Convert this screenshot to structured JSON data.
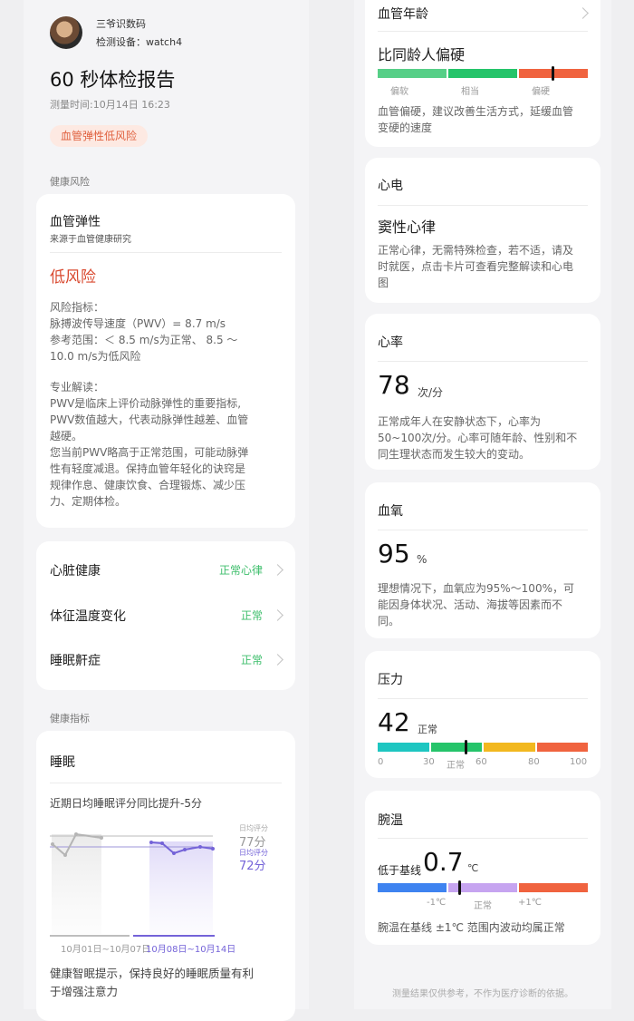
{
  "profile": {
    "name": "三爷识数码",
    "device": "检测设备：watch4"
  },
  "report": {
    "title": "60 秒体检报告",
    "time": "测量时间:10月14日 16:23",
    "risk_badge": "血管弹性低风险"
  },
  "health_risk": {
    "section_label": "健康风险",
    "title": "血管弹性",
    "source": "来源于血管健康研究",
    "level": "低风险",
    "indicator_heading": "风险指标：",
    "indicator_line1": "脉搏波传导速度（PWV）= 8.7 m/s",
    "indicator_line2": "参考范围：＜ 8.5 m/s为正常、 8.5 ～",
    "indicator_line3": "10.0 m/s为低风险",
    "interp_heading": "专业解读：",
    "interp_lines": [
      "PWV是临床上评价动脉弹性的重要指标,",
      "PWV数值越大，代表动脉弹性越差、血管",
      "越硬。",
      "您当前PWV略高于正常范围，可能动脉弹",
      "性有轻度减退。保持血管年轻化的诀窍是",
      "规律作息、健康饮食、合理锻炼、减少压",
      "力、定期体检。"
    ]
  },
  "checks": [
    {
      "label": "心脏健康",
      "status": "正常心律"
    },
    {
      "label": "体征温度变化",
      "status": "正常"
    },
    {
      "label": "睡眠鼾症",
      "status": "正常"
    }
  ],
  "indicators": {
    "section_label": "健康指标",
    "sleep": {
      "title": "睡眠",
      "subtitle": "近期日均睡眠评分同比提升-5分",
      "prev_avg_label": "日均评分",
      "prev_avg_value": "77分",
      "curr_avg_label": "日均评分",
      "curr_avg_value": "72分",
      "range_prev": "10月01日~10月07日",
      "range_curr": "10月08日~10月14日",
      "tip_line1": "健康智眠提示，保持良好的睡眠质量有利",
      "tip_line2": "于增强注意力"
    }
  },
  "right": {
    "vascular_age": {
      "title": "血管年龄",
      "result": "比同龄人偏硬",
      "labels": [
        "偏软",
        "相当",
        "偏硬"
      ],
      "desc_line1": "血管偏硬，建议改善生活方式，延缓血管",
      "desc_line2": "变硬的速度"
    },
    "ecg": {
      "title": "心电",
      "result": "窦性心律",
      "desc_line1": "正常心律，无需特殊检查，若不适，请及",
      "desc_line2": "时就医，点击卡片可查看完整解读和心电",
      "desc_line3": "图"
    },
    "heart_rate": {
      "title": "心率",
      "value": "78",
      "unit": "次/分",
      "desc_line1": "正常成年人在安静状态下，心率为",
      "desc_line2": "50~100次/分。心率可随年龄、性别和不",
      "desc_line3": "同生理状态而发生较大的变动。"
    },
    "spo2": {
      "title": "血氧",
      "value": "95",
      "unit": "%",
      "desc_line1": "理想情况下，血氧应为95%～100%，可",
      "desc_line2": "能因身体状况、活动、海拔等因素而不",
      "desc_line3": "同。"
    },
    "stress": {
      "title": "压力",
      "value": "42",
      "state": "正常",
      "level_fraction": 0.42,
      "ticks": [
        "0",
        "30",
        "正常",
        "60",
        "80",
        "100"
      ]
    },
    "wrist_temp": {
      "title": "腕温",
      "prefix": "低于基线",
      "value": "0.7",
      "unit": "℃",
      "labels": [
        "-1℃",
        "正常",
        "+1℃"
      ],
      "desc": "腕温在基线 ±1℃ 范围内波动均属正常"
    },
    "footer": "测量结果仅供参考，不作为医疗诊断的依据。"
  },
  "colors": {
    "green": "#45c87a",
    "red": "#f0633f",
    "orange_badge_bg": "#fde9e2",
    "orange_badge_text": "#e0613f",
    "risk_text": "#d9492f",
    "status_green": "#3dbe6b",
    "purple": "#7463d8",
    "stress_teal": "#1ec6c1",
    "stress_yellow": "#f2b81f",
    "temp_blue": "#3e83f0",
    "temp_lilac": "#c6a4f0"
  }
}
